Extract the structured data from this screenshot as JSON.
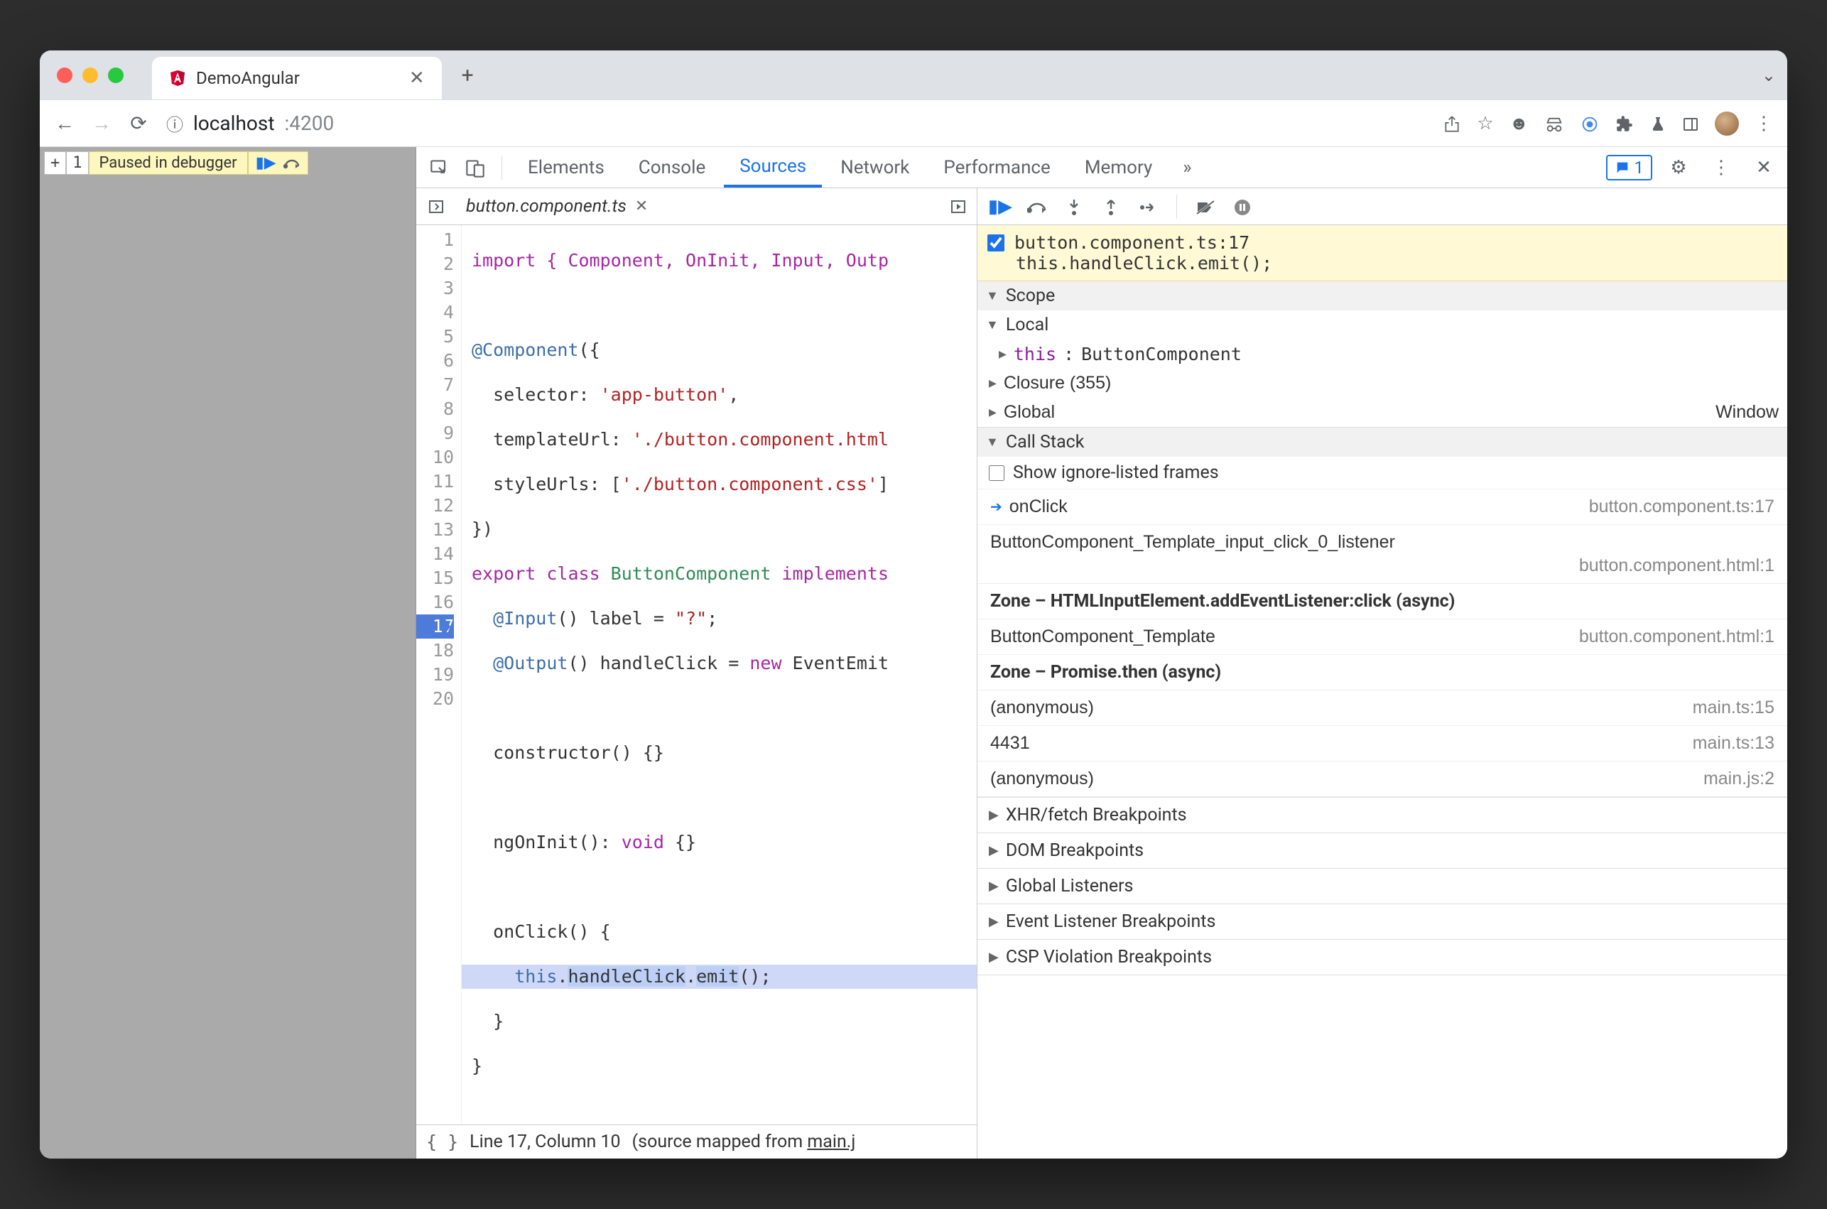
{
  "browser": {
    "tab_title": "DemoAngular",
    "url_host": "localhost",
    "url_port": ":4200"
  },
  "paused_overlay": {
    "line_num": "1",
    "label": "Paused in debugger"
  },
  "devtools_tabs": {
    "elements": "Elements",
    "console": "Console",
    "sources": "Sources",
    "network": "Network",
    "performance": "Performance",
    "memory": "Memory",
    "issues_count": "1"
  },
  "editor": {
    "file_name": "button.component.ts",
    "lines": {
      "1": "import { Component, OnInit, Input, Outp",
      "3a": "@Component",
      "3b": "({",
      "4a": "  selector: ",
      "4b": "'app-button'",
      "4c": ",",
      "5a": "  templateUrl: ",
      "5b": "'./button.component.html",
      "6a": "  styleUrls: [",
      "6b": "'./button.component.css'",
      "6c": "]",
      "7": "})",
      "8a": "export",
      "8b": " class ",
      "8c": "ButtonComponent",
      "8d": " implements",
      "9a": "  @Input",
      "9b": "() label = ",
      "9c": "\"?\"",
      "9d": ";",
      "10a": "  @Output",
      "10b": "() handleClick = ",
      "10c": "new",
      "10d": " EventEmit",
      "12": "  constructor() {}",
      "14a": "  ngOnInit(): ",
      "14b": "void",
      "14c": " {}",
      "16": "  onClick() {",
      "17a": "    this",
      "17b": ".",
      "17c": "handleClick",
      "17d": ".",
      "17e": "emit",
      "17f": "();",
      "18": "  }",
      "19": "}"
    },
    "gutter": [
      "1",
      "2",
      "3",
      "4",
      "5",
      "6",
      "7",
      "8",
      "9",
      "10",
      "11",
      "12",
      "13",
      "14",
      "15",
      "16",
      "17",
      "18",
      "19",
      "20"
    ],
    "status_line": "Line 17, Column 10",
    "status_mapped_prefix": "(source mapped from ",
    "status_mapped_link": "main.j"
  },
  "debugger": {
    "breakpoint_location": "button.component.ts:17",
    "breakpoint_code": "this.handleClick.emit();",
    "scope_title": "Scope",
    "local_title": "Local",
    "this_key": "this",
    "this_val": "ButtonComponent",
    "closure_label": "Closure (355)",
    "global_label": "Global",
    "global_val": "Window",
    "callstack_title": "Call Stack",
    "show_ignore": "Show ignore-listed frames",
    "frames": [
      {
        "name": "onClick",
        "loc": "button.component.ts:17",
        "current": true,
        "long": false
      },
      {
        "name": "ButtonComponent_Template_input_click_0_listener",
        "loc": "button.component.html:1",
        "current": false,
        "long": true
      }
    ],
    "zone1": "Zone – HTMLInputElement.addEventListener:click (async)",
    "frame3": {
      "name": "ButtonComponent_Template",
      "loc": "button.component.html:1"
    },
    "zone2": "Zone – Promise.then (async)",
    "frame4": {
      "name": "(anonymous)",
      "loc": "main.ts:15"
    },
    "frame5": {
      "name": "4431",
      "loc": "main.ts:13"
    },
    "frame6": {
      "name": "(anonymous)",
      "loc": "main.js:2"
    },
    "more": {
      "xhr": "XHR/fetch Breakpoints",
      "dom": "DOM Breakpoints",
      "gl": "Global Listeners",
      "el": "Event Listener Breakpoints",
      "csp": "CSP Violation Breakpoints"
    }
  }
}
